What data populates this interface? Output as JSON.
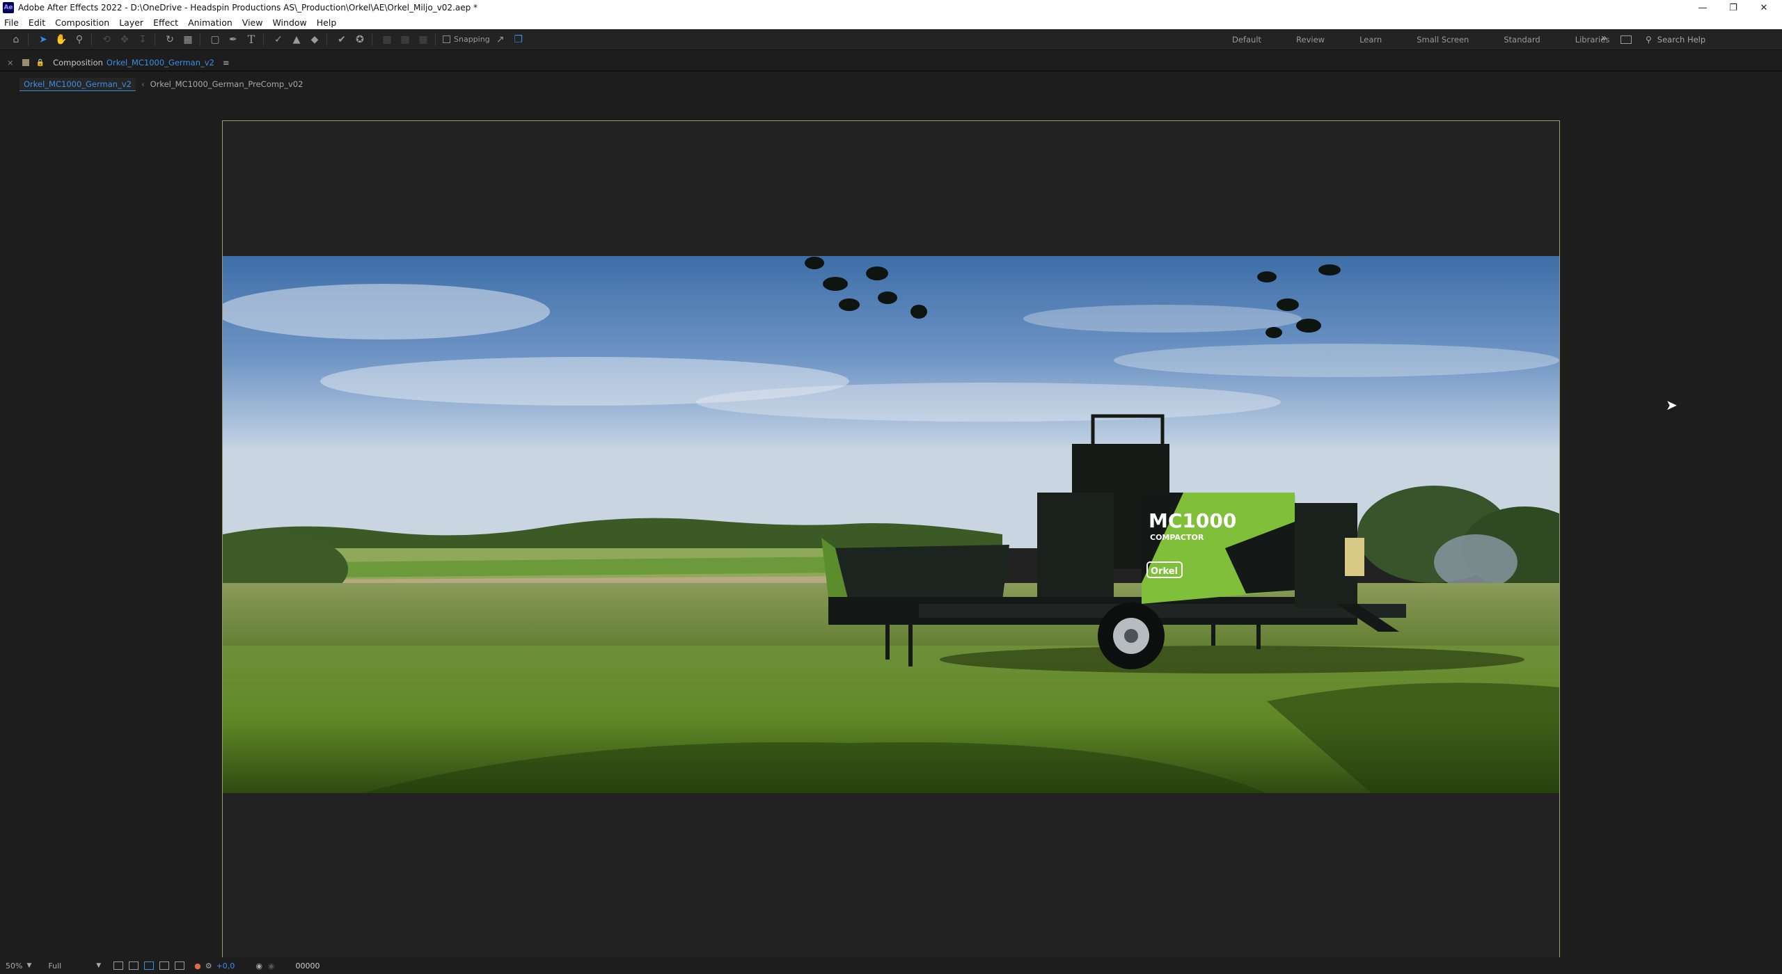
{
  "window": {
    "title": "Adobe After Effects 2022 - D:\\OneDrive - Headspin Productions AS\\_Production\\Orkel\\AE\\Orkel_Miljo_v02.aep *",
    "app_icon": "Ae",
    "controls": [
      "minimize-icon",
      "restore-icon",
      "close-icon"
    ]
  },
  "menu": [
    "File",
    "Edit",
    "Composition",
    "Layer",
    "Effect",
    "Animation",
    "View",
    "Window",
    "Help"
  ],
  "toolbar": {
    "snapping_label": "Snapping",
    "workspaces": [
      "Default",
      "Review",
      "Learn",
      "Small Screen",
      "Standard",
      "Libraries"
    ],
    "search_placeholder": "Search Help"
  },
  "panel": {
    "label": "Composition",
    "composition_name": "Orkel_MC1000_German_v2",
    "menu_glyph": "≡"
  },
  "tabs": [
    "Orkel_MC1000_German_v2",
    "Orkel_MC1000_German_PreComp_v02"
  ],
  "image": {
    "machine_label": "MC1000",
    "machine_sublabel": "COMPACTOR",
    "brand": "Orkel"
  },
  "statusbar": {
    "zoom": "50%",
    "resolution": "Full",
    "exposure": "+0,0",
    "timecode": "00000"
  }
}
